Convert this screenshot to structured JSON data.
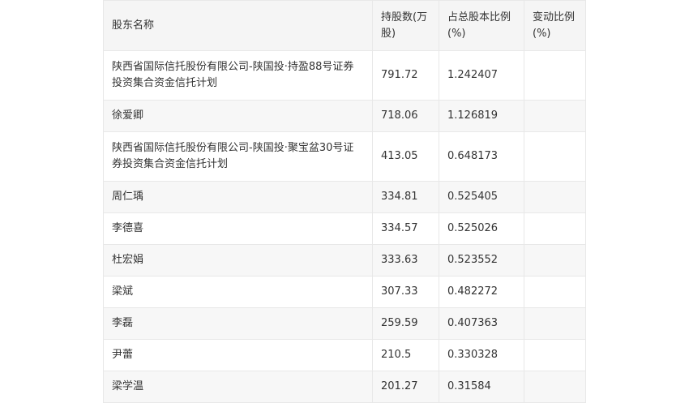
{
  "table": {
    "headers": [
      "股东名称",
      "持股数(万股)",
      "占总股本比例(%)",
      "变动比例(%)"
    ],
    "rows": [
      {
        "name": "陕西省国际信托股份有限公司-陕国投·持盈88号证券投资集合资金信托计划",
        "shares": "791.72",
        "ratio": "1.242407",
        "change": ""
      },
      {
        "name": "徐爱卿",
        "shares": "718.06",
        "ratio": "1.126819",
        "change": ""
      },
      {
        "name": "陕西省国际信托股份有限公司-陕国投·聚宝盆30号证券投资集合资金信托计划",
        "shares": "413.05",
        "ratio": "0.648173",
        "change": ""
      },
      {
        "name": "周仁瑀",
        "shares": "334.81",
        "ratio": "0.525405",
        "change": ""
      },
      {
        "name": "李德喜",
        "shares": "334.57",
        "ratio": "0.525026",
        "change": ""
      },
      {
        "name": "杜宏娟",
        "shares": "333.63",
        "ratio": "0.523552",
        "change": ""
      },
      {
        "name": "梁斌",
        "shares": "307.33",
        "ratio": "0.482272",
        "change": ""
      },
      {
        "name": "李磊",
        "shares": "259.59",
        "ratio": "0.407363",
        "change": ""
      },
      {
        "name": "尹蕾",
        "shares": "210.5",
        "ratio": "0.330328",
        "change": ""
      },
      {
        "name": "梁学温",
        "shares": "201.27",
        "ratio": "0.31584",
        "change": ""
      }
    ]
  }
}
